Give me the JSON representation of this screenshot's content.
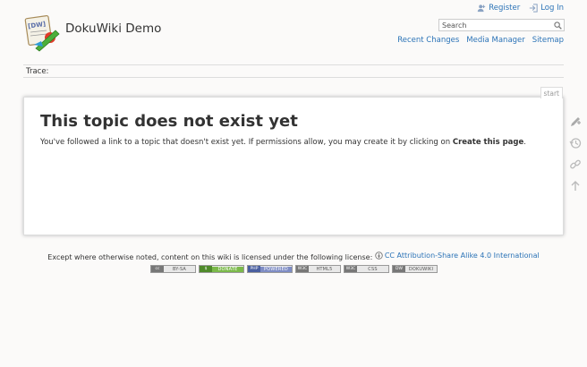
{
  "header": {
    "site_title": "DokuWiki Demo",
    "logo_icon": "dokuwiki-logo-icon"
  },
  "user_tools": {
    "register_label": "Register",
    "login_label": "Log In"
  },
  "search": {
    "placeholder": "Search",
    "icon": "search-icon"
  },
  "site_tools": {
    "recent_changes": "Recent Changes",
    "media_manager": "Media Manager",
    "sitemap": "Sitemap"
  },
  "trace": {
    "label": "Trace:"
  },
  "page": {
    "id": "start",
    "title": "This topic does not exist yet",
    "text_before": "You've followed a link to a topic that doesn't exist yet. If permissions allow, you may create it by clicking on ",
    "text_bold": "Create this page",
    "text_after": "."
  },
  "page_tools": [
    "create-page-icon",
    "old-revisions-icon",
    "backlinks-icon",
    "back-to-top-icon"
  ],
  "footer": {
    "license_text": "Except where otherwise noted, content on this wiki is licensed under the following license:",
    "license_link": "CC Attribution-Share Alike 4.0 International",
    "badges": [
      {
        "left": "cc",
        "right": "BY-SA"
      },
      {
        "left": "$",
        "right": "DONATE"
      },
      {
        "left": "PHP",
        "right": "POWERED"
      },
      {
        "left": "W3C",
        "right": "HTML5"
      },
      {
        "left": "W3C",
        "right": "CSS"
      },
      {
        "left": "DW",
        "right": "DOKUWIKI"
      }
    ]
  },
  "colors": {
    "link": "#2b73b7",
    "background": "#fbfaf9",
    "page_bg": "#ffffff"
  }
}
